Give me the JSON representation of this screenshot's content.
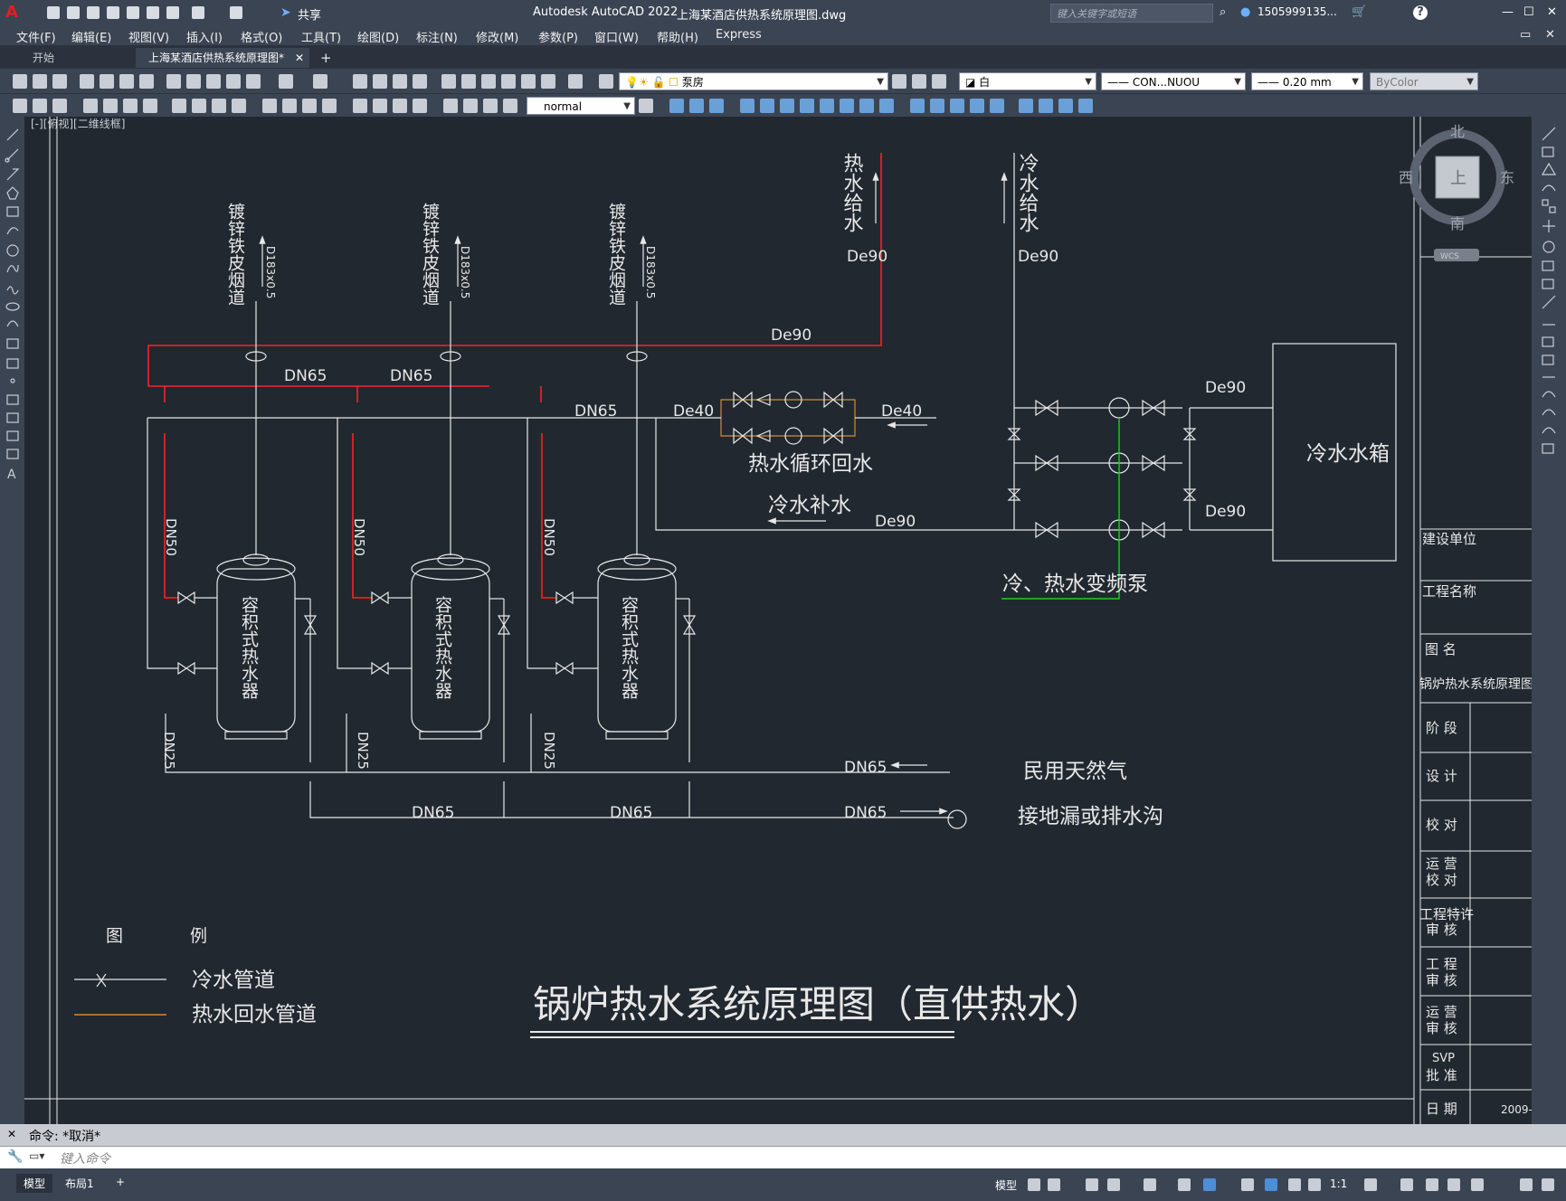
{
  "titlebar": {
    "app_title": "Autodesk AutoCAD 2022",
    "file_name": "上海某酒店供热系统原理图.dwg",
    "share_label": "共享",
    "search_placeholder": "键入关键字或短语",
    "user": "1505999135...",
    "help": "?"
  },
  "menu": [
    "文件(F)",
    "编辑(E)",
    "视图(V)",
    "插入(I)",
    "格式(O)",
    "工具(T)",
    "绘图(D)",
    "标注(N)",
    "修改(M)",
    "参数(P)",
    "窗口(W)",
    "帮助(H)",
    "Express"
  ],
  "tabs": {
    "start": "开始",
    "drawing": "上海某酒店供热系统原理图*",
    "close": "✕",
    "add": "+"
  },
  "toolbar": {
    "layer": "泵房",
    "color": "白",
    "linetype": "CON...NUOU",
    "lineweight": "0.20 mm",
    "plotstyle": "ByColor",
    "textstyle": "normal"
  },
  "viewport_label": "[-][俯视][二维线框]",
  "viewcube": {
    "north": "北",
    "south": "南",
    "east": "东",
    "west": "西",
    "face": "上",
    "wcs": "WCS"
  },
  "drawing": {
    "title": "锅炉热水系统原理图（直供热水）",
    "flue_label": "镀锌铁皮烟道",
    "flue_size": "D183x0.5",
    "hot_supply": "热水给水",
    "cold_supply": "冷水给水",
    "de90": "De90",
    "de40": "De40",
    "dn65": "DN65",
    "dn50": "DN50",
    "dn25": "DN25",
    "heater_label": "容积式热水器",
    "hot_return": "热水循环回水",
    "cold_makeup": "冷水补水",
    "pump_label": "冷、热水变频泵",
    "tank_label": "冷水水箱",
    "gas_label": "民用天然气",
    "drain_label": "接地漏或排水沟",
    "legend_title_1": "图",
    "legend_title_2": "例",
    "legend_cold": "冷水管道",
    "legend_hot": "热水回水管道"
  },
  "title_block": {
    "client": "建设单位",
    "project": "工程名称",
    "drawing_name_label": "图 名",
    "drawing_name": "锅炉热水系统原理图",
    "stage": "阶 段",
    "design": "设 计",
    "check": "校 对",
    "op_check_1": "运 营",
    "op_check_2": "校 对",
    "eng_special_1": "工程特许",
    "eng_special_2": "审 核",
    "eng_review_1": "工 程",
    "eng_review_2": "审 核",
    "op_review_1": "运 营",
    "op_review_2": "审 核",
    "svp_1": "SVP",
    "svp_2": "批 准",
    "date": "日 期",
    "date_value": "2009-"
  },
  "command": {
    "history": "命令:  *取消*",
    "placeholder": "键入命令"
  },
  "status": {
    "model": "模型",
    "layout1": "布局1",
    "add": "+",
    "model_btn": "模型",
    "scale": "1:1"
  },
  "colors": {
    "red": "#ff2020",
    "white": "#e8e8e8",
    "green": "#22cc22",
    "orange": "#d48a3a",
    "bg": "#212830"
  }
}
